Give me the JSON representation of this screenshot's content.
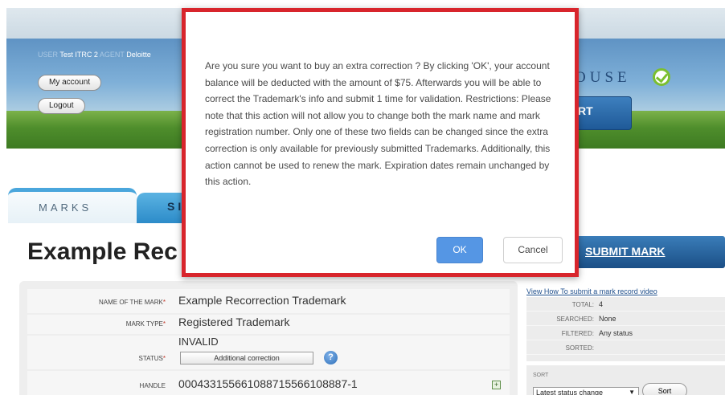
{
  "header": {
    "user_label": "USER",
    "user_value": "Test ITRC 2",
    "agent_label": "AGENT",
    "agent_value": "Deloitte",
    "my_account_label": "My account",
    "logout_label": "Logout",
    "brand_text": "OUSE",
    "cta_label": "RT"
  },
  "tabs": {
    "marks_label": "MARKS",
    "second_label": "SI"
  },
  "page": {
    "title": "Example Rec",
    "submit_label": "SUBMIT MARK"
  },
  "form": {
    "name_label": "NAME OF THE MARK",
    "name_value": "Example Recorrection Trademark",
    "type_label": "MARK TYPE",
    "type_value": "Registered Trademark",
    "status_label": "STATUS",
    "status_value": "INVALID",
    "status_button_label": "Additional correction",
    "help_glyph": "?",
    "handle_label": "HANDLE",
    "handle_value": "000433155661088715566108887-1",
    "expand_glyph": "+"
  },
  "stats": {
    "video_link": "View How To submit a mark record video",
    "rows": [
      {
        "key": "TOTAL:",
        "value": "4"
      },
      {
        "key": "SEARCHED:",
        "value": "None"
      },
      {
        "key": "FILTERED:",
        "value": "Any status"
      },
      {
        "key": "SORTED:",
        "value": ""
      }
    ],
    "sort_title": "SORT",
    "sort_selected": "Latest status change",
    "sort_button": "Sort"
  },
  "dialog": {
    "message": "Are you sure you want to buy an extra correction ? By clicking 'OK', your account balance will be deducted with the amount of $75. Afterwards you will be able to correct the Trademark's info and submit 1 time for validation. Restrictions: Please note that this action will not allow you to change both the mark name and mark registration number. Only one of these two fields can be changed since the extra correction is only available for previously submitted Trademarks. Additionally, this action cannot be used to renew the mark. Expiration dates remain unchanged by this action.",
    "ok_label": "OK",
    "cancel_label": "Cancel"
  },
  "colors": {
    "dialog_border": "#d8252c",
    "ok_button": "#5596e4",
    "tab_accent": "#4aa6dc",
    "submit_button": "#1b4f86"
  }
}
